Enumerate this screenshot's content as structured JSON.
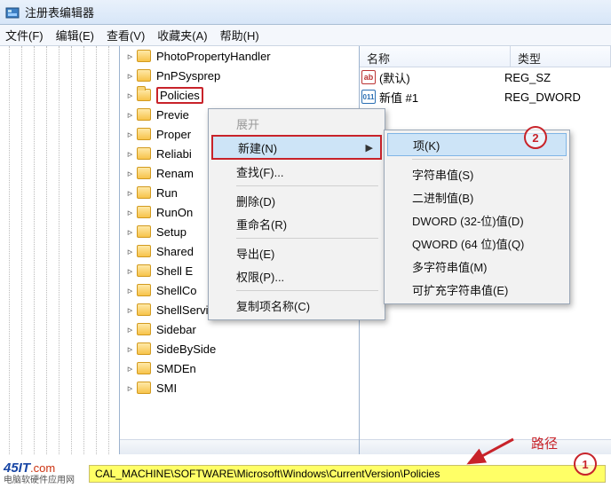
{
  "window": {
    "title": "注册表编辑器"
  },
  "menubar": [
    "文件(F)",
    "编辑(E)",
    "查看(V)",
    "收藏夹(A)",
    "帮助(H)"
  ],
  "tree_nodes": [
    "PhotoPropertyHandler",
    "PnPSysprep",
    "Policies",
    "Previe",
    "Proper",
    "Reliabi",
    "Renam",
    "Run",
    "RunOn",
    "Setup",
    "Shared",
    "Shell E",
    "ShellCo",
    "ShellServiceObjectDelayLoad",
    "Sidebar",
    "SideBySide",
    "SMDEn",
    "SMI"
  ],
  "selected_index": 2,
  "right": {
    "headers": {
      "name": "名称",
      "type": "类型"
    },
    "rows": [
      {
        "icon": "ab",
        "name": "(默认)",
        "type": "REG_SZ"
      },
      {
        "icon": "bn",
        "name": "新值 #1",
        "type": "REG_DWORD"
      }
    ]
  },
  "context_menu": {
    "title": "展开",
    "items": [
      {
        "label": "新建(N)",
        "hi": true,
        "arrow": true
      },
      {
        "label": "查找(F)..."
      },
      {
        "sep": true
      },
      {
        "label": "删除(D)"
      },
      {
        "label": "重命名(R)"
      },
      {
        "sep": true
      },
      {
        "label": "导出(E)"
      },
      {
        "label": "权限(P)..."
      },
      {
        "sep": true
      },
      {
        "label": "复制项名称(C)"
      }
    ]
  },
  "submenu": {
    "items": [
      {
        "label": "项(K)",
        "hi": true
      },
      {
        "sep": true
      },
      {
        "label": "字符串值(S)"
      },
      {
        "label": "二进制值(B)"
      },
      {
        "label": "DWORD (32-位)值(D)"
      },
      {
        "label": "QWORD (64 位)值(Q)"
      },
      {
        "label": "多字符串值(M)"
      },
      {
        "label": "可扩充字符串值(E)"
      }
    ]
  },
  "status_path": "CAL_MACHINE\\SOFTWARE\\Microsoft\\Windows\\CurrentVersion\\Policies",
  "annotations": {
    "path_label": "路径",
    "a1": "1",
    "a2": "2"
  },
  "logo": {
    "main": "45IT",
    "dot": ".com",
    "sub": "电脑软硬件应用网"
  }
}
